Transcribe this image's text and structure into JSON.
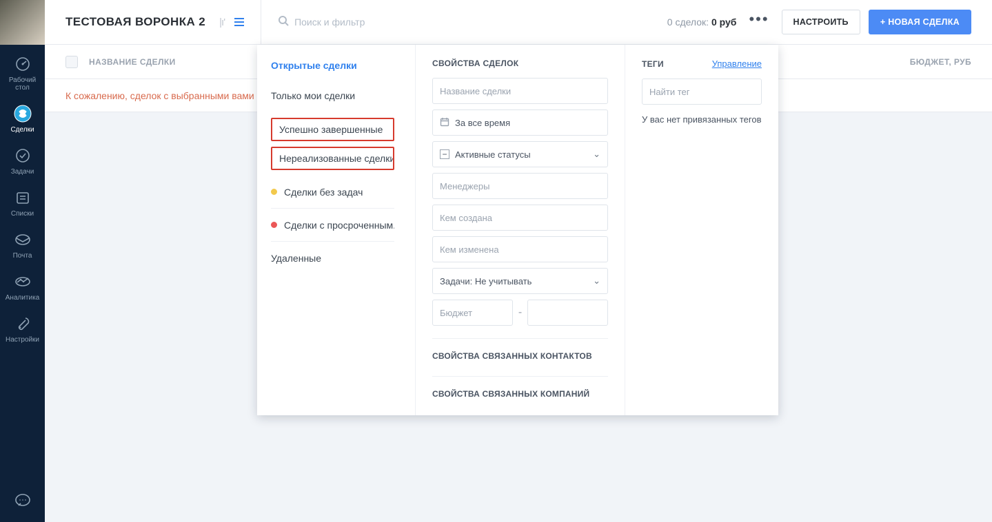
{
  "sidebar": {
    "items": [
      {
        "label": "Рабочий\nстол"
      },
      {
        "label": "Сделки"
      },
      {
        "label": "Задачи"
      },
      {
        "label": "Списки"
      },
      {
        "label": "Почта"
      },
      {
        "label": "Аналитика"
      },
      {
        "label": "Настройки"
      }
    ]
  },
  "header": {
    "title": "ТЕСТОВАЯ ВОРОНКА 2",
    "search_placeholder": "Поиск и фильтр",
    "summary_count": "0 сделок:",
    "summary_value": "0 руб",
    "configure": "Настроить",
    "new_deal": "+ Новая сделка"
  },
  "table": {
    "col_name": "Название сделки",
    "col_budget": "Бюджет, руб",
    "empty": "К сожалению, сделок с выбранными вами"
  },
  "filter": {
    "presets": [
      "Открытые сделки",
      "Только мои сделки",
      "Успешно завершенные",
      "Нереализованные сделки",
      "Сделки без задач",
      "Сделки с просроченным...",
      "Удаленные"
    ],
    "props_title": "Свойства сделок",
    "deal_name_placeholder": "Название сделки",
    "date_label": "За все время",
    "status_label": "Активные статусы",
    "managers_placeholder": "Менеджеры",
    "created_by_placeholder": "Кем создана",
    "modified_by_placeholder": "Кем изменена",
    "tasks_label": "Задачи: Не учитывать",
    "budget_placeholder": "Бюджет",
    "contacts_title": "Свойства связанных контактов",
    "companies_title": "Свойства связанных компаний",
    "tags_title": "Теги",
    "tags_manage": "Управление",
    "tags_search_placeholder": "Найти тег",
    "tags_empty": "У вас нет привязанных тегов"
  }
}
